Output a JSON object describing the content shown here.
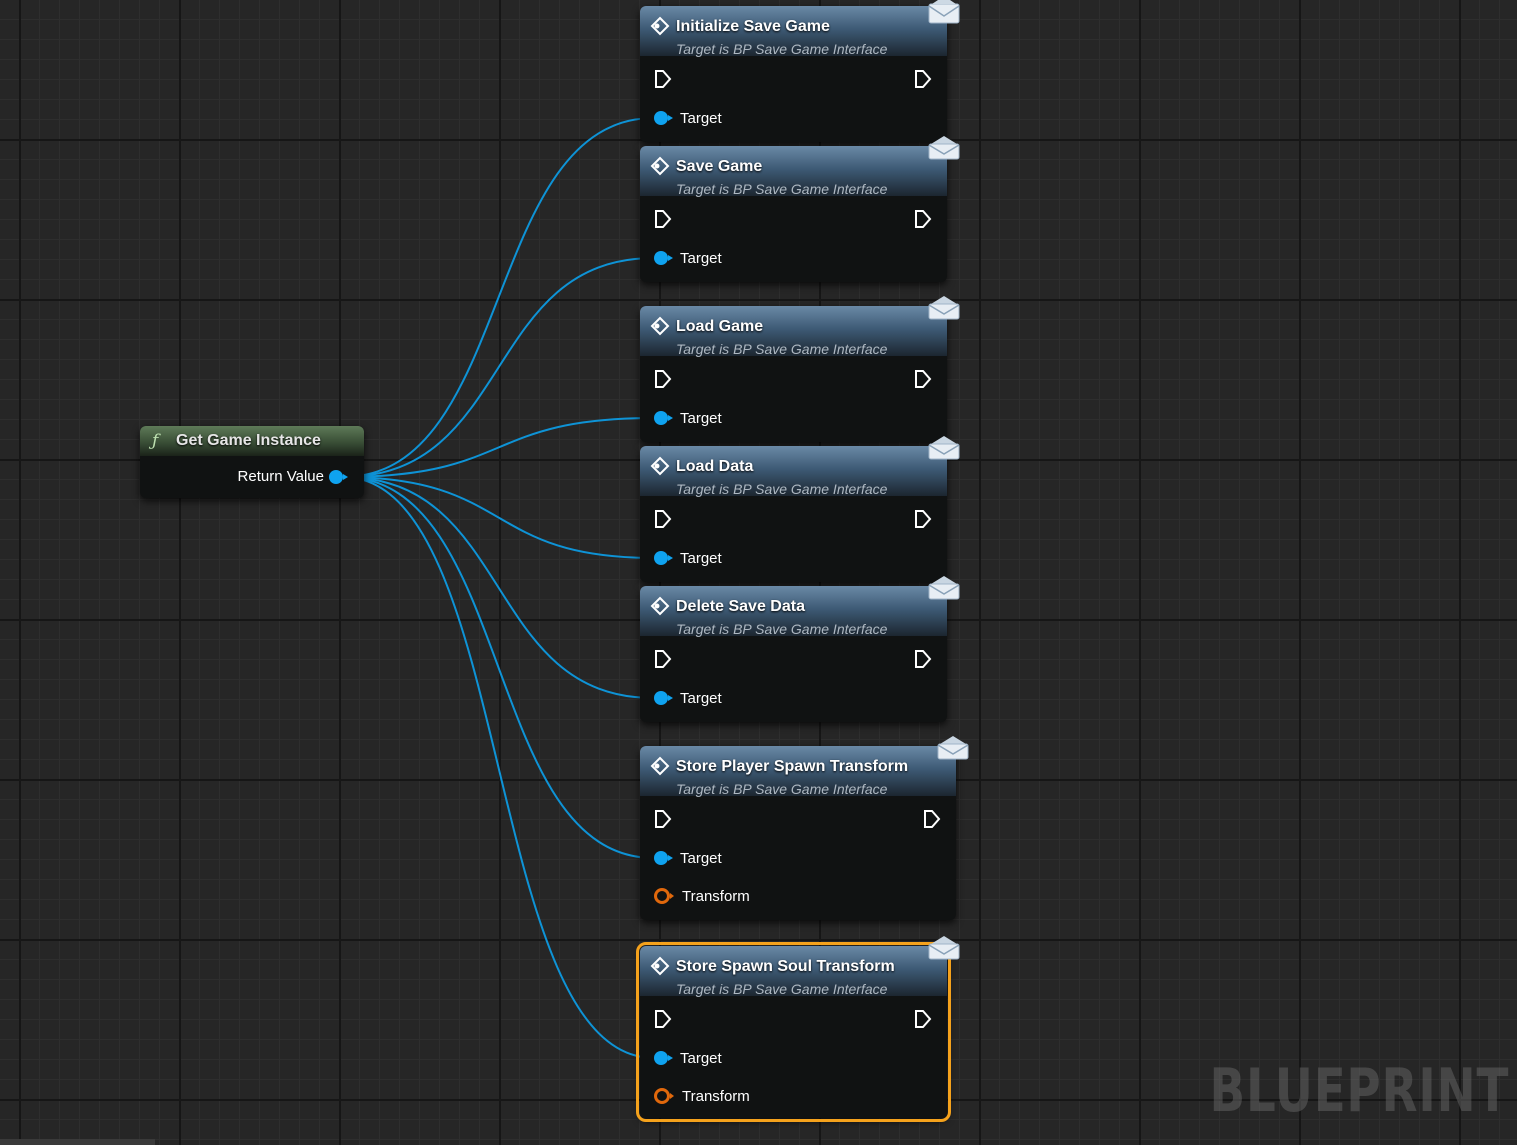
{
  "watermark": "BLUEPRINT",
  "source_node": {
    "title": "Get Game Instance",
    "output_pin": "Return Value",
    "icon": "function-icon"
  },
  "nodes": [
    {
      "id": "initialize-save-game",
      "title": "Initialize Save Game",
      "subtitle": "Target is BP Save Game Interface",
      "pins": [
        "Target"
      ]
    },
    {
      "id": "save-game",
      "title": "Save Game",
      "subtitle": "Target is BP Save Game Interface",
      "pins": [
        "Target"
      ]
    },
    {
      "id": "load-game",
      "title": "Load Game",
      "subtitle": "Target is BP Save Game Interface",
      "pins": [
        "Target"
      ]
    },
    {
      "id": "load-data",
      "title": "Load Data",
      "subtitle": "Target is BP Save Game Interface",
      "pins": [
        "Target"
      ]
    },
    {
      "id": "delete-save-data",
      "title": "Delete Save Data",
      "subtitle": "Target is BP Save Game Interface",
      "pins": [
        "Target"
      ]
    },
    {
      "id": "store-player-spawn-transform",
      "title": "Store Player Spawn Transform",
      "subtitle": "Target is BP Save Game Interface",
      "pins": [
        "Target",
        "Transform"
      ]
    },
    {
      "id": "store-spawn-soul-transform",
      "title": "Store Spawn Soul Transform",
      "subtitle": "Target is BP Save Game Interface",
      "pins": [
        "Target",
        "Transform"
      ],
      "selected": true
    }
  ],
  "colors": {
    "wire": "#0e93d6",
    "object_pin": "#0fa3f0",
    "struct_pin": "#e0680c",
    "selection": "#f5a21c",
    "message_header": "#4d6c8a",
    "function_header": "#4e6a49"
  },
  "icons": [
    "message-icon",
    "exec-pin-icon",
    "envelope-icon",
    "function-icon"
  ]
}
